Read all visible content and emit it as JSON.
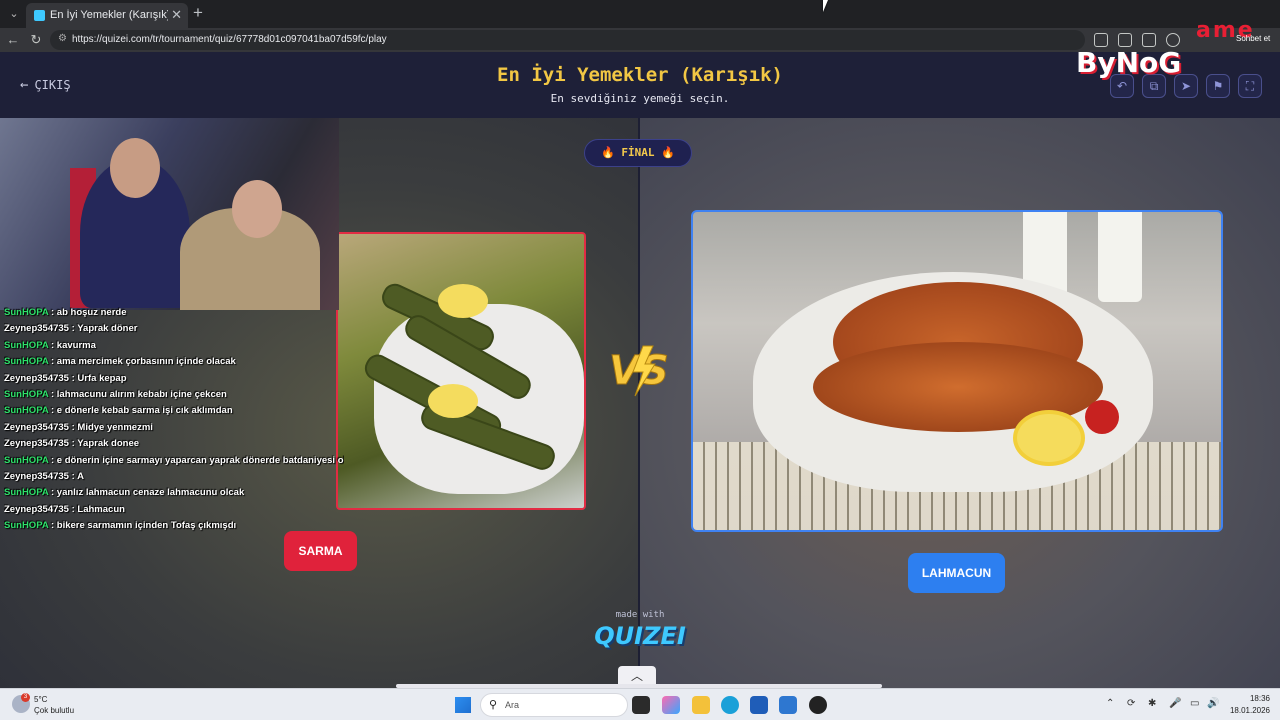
{
  "browser": {
    "tab_title": "En İyi Yemekler (Karışık) - Tier List",
    "tab_close": "✕",
    "new_tab": "+",
    "url": "https://quizei.com/tr/tournament/quiz/67778d01c097041ba07d59fc/play"
  },
  "header": {
    "exit_label": "ÇIKIŞ",
    "title": "En İyi Yemekler (Karışık)",
    "subtitle": "En sevdiğiniz yemeği seçin."
  },
  "round": {
    "badge": "🔥 FİNAL 🔥"
  },
  "choices": {
    "left_label": "SARMA",
    "right_label": "LAHMACUN"
  },
  "footer": {
    "made_with": "made with",
    "brand": "QUIZEI",
    "collapse_icon": "︿"
  },
  "stream": {
    "watermark": "ByNoGame",
    "watermark_main": "ByNoG",
    "watermark_game": "ame",
    "sohbet": "Sohbet et",
    "chat": [
      {
        "user": "SunHOPA",
        "msg": "ab hoşuz nerde"
      },
      {
        "user": "Zeynep354735",
        "msg": "Yaprak döner"
      },
      {
        "user": "SunHOPA",
        "msg": "kavurma"
      },
      {
        "user": "SunHOPA",
        "msg": "ama mercimek çorbasının içinde olacak"
      },
      {
        "user": "Zeynep354735",
        "msg": "Urfa kepap"
      },
      {
        "user": "SunHOPA",
        "msg": "lahmacunu alırım kebabı içine çekcen"
      },
      {
        "user": "SunHOPA",
        "msg": "e dönerle kebab sarma işi cık aklımdan"
      },
      {
        "user": "Zeynep354735",
        "msg": "Midye yenmezmi"
      },
      {
        "user": "Zeynep354735",
        "msg": "Yaprak donee"
      },
      {
        "user": "SunHOPA",
        "msg": "e dönerin içine sarmayı yaparcan yaprak dönerde batdaniyesi olcak"
      },
      {
        "user": "Zeynep354735",
        "msg": "A"
      },
      {
        "user": "SunHOPA",
        "msg": "yanlız lahmacun cenaze lahmacunu olcak"
      },
      {
        "user": "Zeynep354735",
        "msg": "Lahmacun"
      },
      {
        "user": "SunHOPA",
        "msg": "bikere sarmamın içinden Tofaş çıkmışdı"
      }
    ]
  },
  "taskbar": {
    "weather_temp": "5°C",
    "weather_desc": "Çok bulutlu",
    "weather_badge": "3",
    "search_placeholder": "Ara",
    "time": "18:36",
    "date": "18.01.2026"
  },
  "colors": {
    "title": "#f2c744",
    "left_accent": "#e0223b",
    "right_accent": "#2d7ff0",
    "chat_user_green": "#2ee06a"
  }
}
